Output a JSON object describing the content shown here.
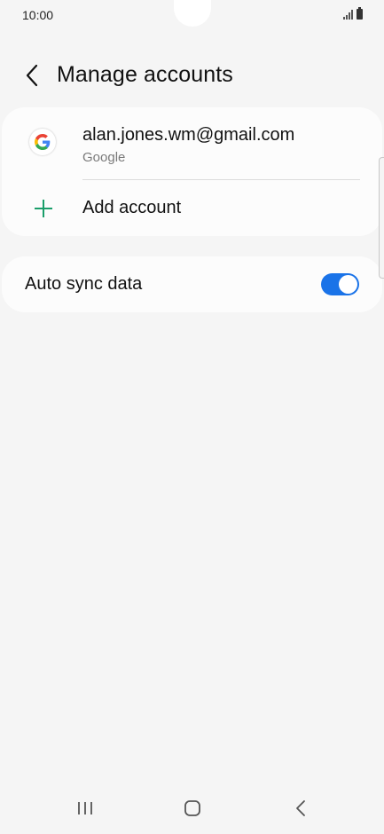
{
  "status_bar": {
    "time": "10:00",
    "icons": [
      "signal-icon",
      "battery-icon"
    ]
  },
  "header": {
    "title": "Manage accounts",
    "back_icon": "chevron-left-icon"
  },
  "accounts": [
    {
      "email": "alan.jones.wm@gmail.com",
      "type": "Google",
      "icon": "google-icon"
    }
  ],
  "add_account": {
    "label": "Add account",
    "icon": "plus-icon",
    "icon_color": "#1a9e6a"
  },
  "auto_sync": {
    "label": "Auto sync data",
    "enabled": true,
    "toggle_color": "#1a73e8"
  },
  "navigation_bar": {
    "buttons": [
      "recents-icon",
      "home-icon",
      "back-icon"
    ]
  }
}
